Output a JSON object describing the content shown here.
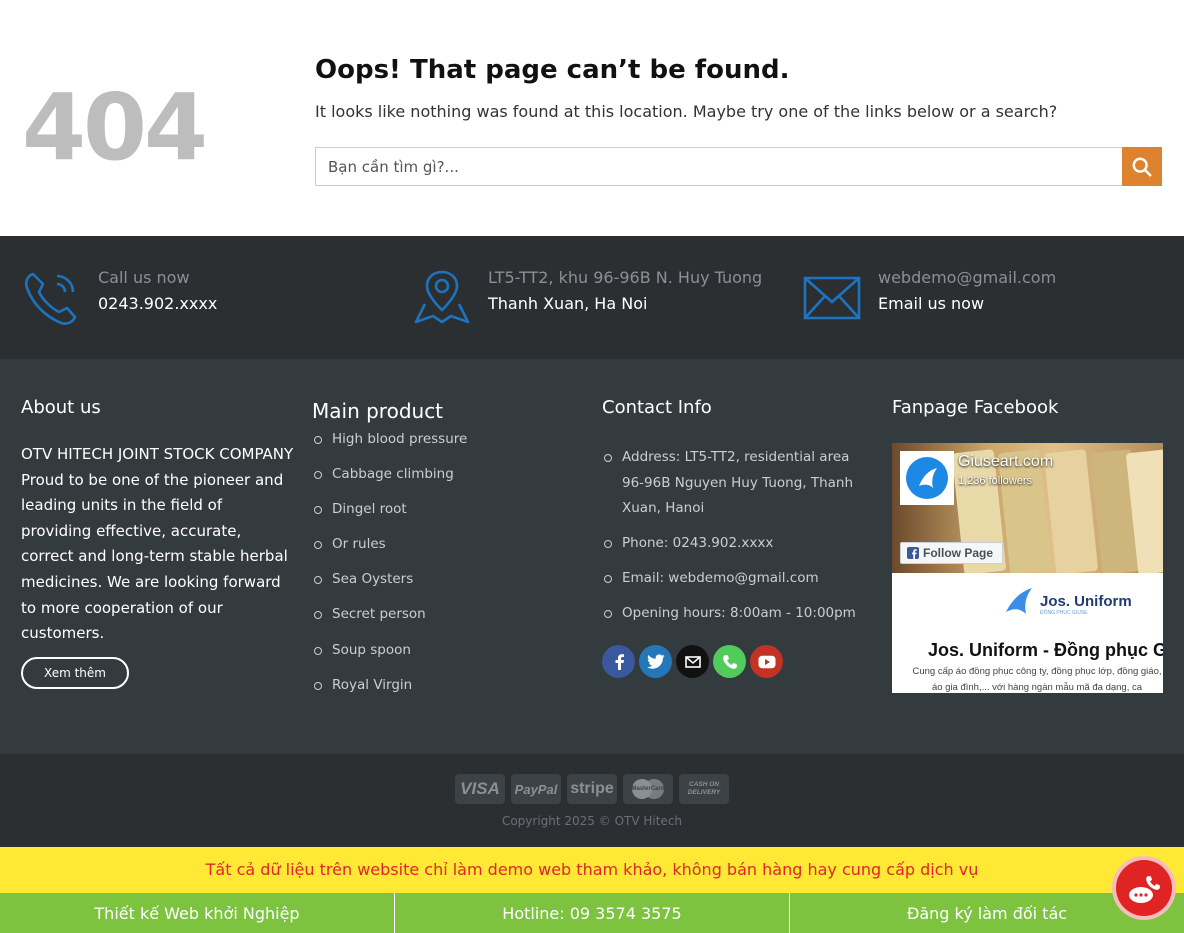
{
  "notfound": {
    "code": "404",
    "title": "Oops! That page can’t be found.",
    "message": "It looks like nothing was found at this location. Maybe try one of the links below or a search?",
    "search_placeholder": "Bạn cần tìm gì?...",
    "search_icon": "search-icon",
    "accent_color": "#dd8330"
  },
  "contact_bar": {
    "items": [
      {
        "icon": "phone-icon",
        "line1": "Call us now",
        "line2": "0243.902.xxxx"
      },
      {
        "icon": "map-icon",
        "line1": "LT5-TT2, khu 96-96B N. Huy Tuong",
        "line2": "Thanh Xuan, Ha Noi"
      },
      {
        "icon": "envelope-icon",
        "line1": "webdemo@gmail.com",
        "line2": "Email us now"
      }
    ],
    "icon_color": "#1e73be"
  },
  "footer": {
    "about": {
      "title": "About us",
      "text": "OTV HITECH JOINT STOCK COMPANY Proud to be one of the pioneer and leading units in the field of providing effective, accurate, correct and long-term stable herbal medicines. We are looking forward to more cooperation of our customers.",
      "button": "Xem thêm"
    },
    "products": {
      "title": "Main product",
      "items": [
        "High blood pressure",
        "Cabbage climbing",
        "Dingel root",
        "Or rules",
        "Sea Oysters",
        "Secret person",
        "Soup spoon",
        "Royal Virgin"
      ]
    },
    "contact": {
      "title": "Contact Info",
      "items": [
        "Address: LT5-TT2, residential area 96-96B Nguyen Huy Tuong, Thanh Xuan, Hanoi",
        "Phone: 0243.902.xxxx",
        "Email: webdemo@gmail.com",
        "Opening hours: 8:00am - 10:00pm"
      ],
      "socials": [
        {
          "icon": "facebook-icon",
          "color": "#3a589d"
        },
        {
          "icon": "twitter-icon",
          "color": "#2478ba"
        },
        {
          "icon": "email-icon",
          "color": "#111111"
        },
        {
          "icon": "phone-call-icon",
          "color": "#51cb5a"
        },
        {
          "icon": "youtube-icon",
          "color": "#c33223"
        }
      ]
    },
    "fanpage": {
      "title": "Fanpage Facebook",
      "page_name": "Giuseart.com",
      "followers": "1,236 followers",
      "follow_label": "Follow Page",
      "post_logo": "Jos. Uniform",
      "post_logo_sub": "ĐỒNG PHỤC GIUSE",
      "post_title": "Jos. Uniform - Đồng phục Gi",
      "post_desc": "Cung cấp áo đồng phục công ty, đồng phục lớp, đồng giáo, áo gia đình,... với hàng ngàn mẫu mã đa dạng, ca"
    }
  },
  "absolute_footer": {
    "payments": [
      "VISA",
      "PayPal",
      "stripe",
      "MasterCard",
      "CASH ON DELIVERY"
    ],
    "copyright": "Copyright 2025 © OTV Hitech"
  },
  "notice": "Tất cả dữ liệu trên website chỉ làm demo web tham khảo, không bán hàng hay cung cấp dịch vụ",
  "bottom_bar": [
    "Thiết kế Web khởi Nghiệp",
    "Hotline: 09 3574 3575",
    "Đăng ký làm đối tác"
  ]
}
